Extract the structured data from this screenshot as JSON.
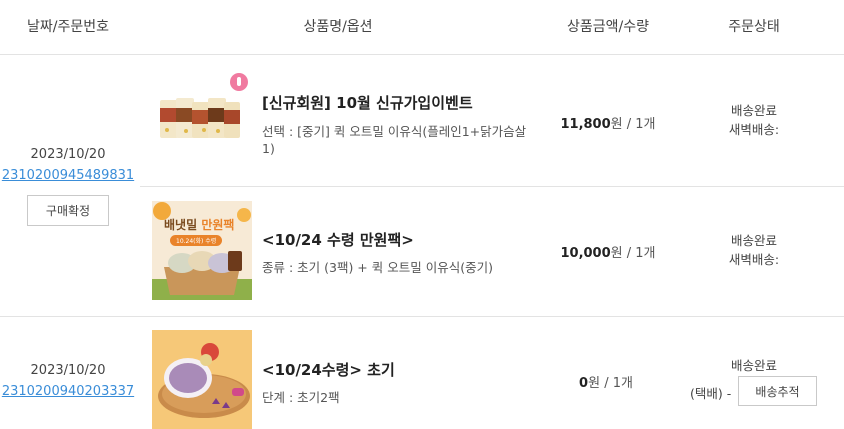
{
  "header": {
    "col_date": "날짜/주문번호",
    "col_product": "상품명/옵션",
    "col_price": "상품금액/수량",
    "col_status": "주문상태"
  },
  "orders": [
    {
      "date": "2023/10/20",
      "number": "2310200945489831",
      "confirm_label": "구매확정",
      "items": [
        {
          "name": "[신규회원] 10월 신규가입이벤트",
          "option": "선택 : [중기] 퀵 오트밀 이유식(플레인1+닭가슴살1)",
          "price": "11,800",
          "won": "원",
          "qty": "/ 1개",
          "status1": "배송완료",
          "status2": "새벽배송:"
        },
        {
          "name": "<10/24 수령 만원팩>",
          "option": "종류 : 초기 (3팩) + 퀵 오트밀 이유식(중기)",
          "price": "10,000",
          "won": "원",
          "qty": "/ 1개",
          "status1": "배송완료",
          "status2": "새벽배송:",
          "banner_title_1": "배냇밀",
          "banner_title_2": "만원팩",
          "banner_sub": "10.24(화) 수령"
        }
      ]
    },
    {
      "date": "2023/10/20",
      "number": "2310200940203337",
      "items": [
        {
          "name": "<10/24수령> 초기",
          "option": "단계 : 초기2팩",
          "price": "0",
          "won": "원",
          "qty": "/ 1개",
          "status1": "배송완료",
          "status2": "(택배) -",
          "tracking_label": "배송추적"
        }
      ]
    }
  ]
}
